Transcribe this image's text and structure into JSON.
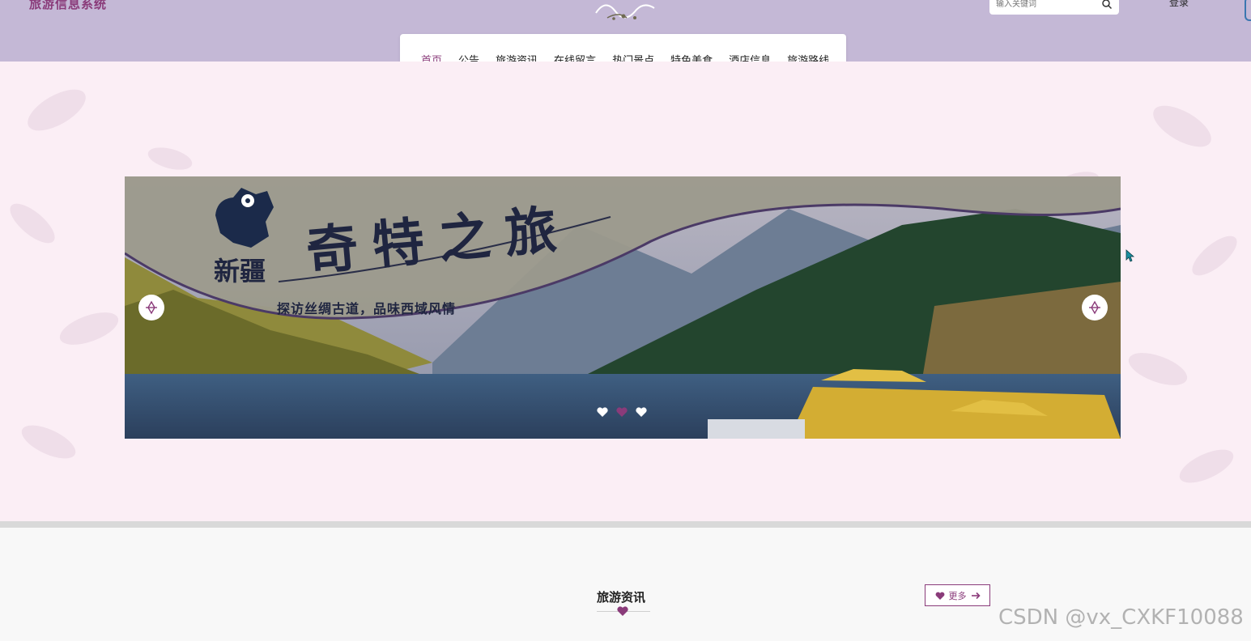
{
  "header": {
    "site_title": "旅游信息系统",
    "search_placeholder": "输入关键词",
    "login_label": "登录"
  },
  "nav": {
    "items": [
      {
        "label": "首页",
        "active": true
      },
      {
        "label": "公告",
        "active": false
      },
      {
        "label": "旅游资讯",
        "active": false
      },
      {
        "label": "在线留言",
        "active": false
      },
      {
        "label": "热门景点",
        "active": false
      },
      {
        "label": "特色美食",
        "active": false
      },
      {
        "label": "酒店信息",
        "active": false
      },
      {
        "label": "旅游路线",
        "active": false
      }
    ]
  },
  "banner": {
    "region": "新疆",
    "title": "奇特之旅",
    "subtitle": "探访丝绸古道，品味西域风情",
    "slide_count": 3,
    "active_slide": 2
  },
  "section": {
    "title": "旅游资讯",
    "more_label": "更多"
  },
  "watermark": "CSDN @vx_CXKF10088",
  "colors": {
    "accent": "#8a3b7a",
    "header_bg": "#c4b8d6",
    "hero_bg": "#fbeef5"
  },
  "icons": {
    "search": "search-icon",
    "heart": "heart-icon",
    "arrow_prev": "compass-arrow-icon",
    "arrow_next": "compass-arrow-icon",
    "more": "arrow-right-icon"
  }
}
